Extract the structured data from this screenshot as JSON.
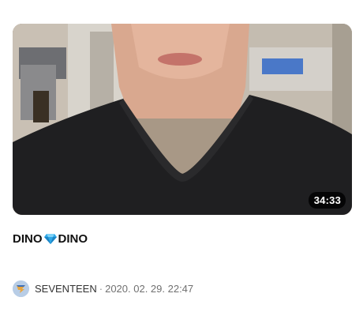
{
  "video": {
    "duration": "34:33",
    "title_part1": "DINO",
    "title_emoji": "diamond-emoji",
    "title_part2": "DINO"
  },
  "channel": {
    "name": "SEVENTEEN",
    "avatar_icon": "seventeen-logo-icon",
    "avatar_color": "#b8cde6"
  },
  "meta": {
    "separator": "·",
    "date": "2020. 02. 29. 22:47"
  }
}
